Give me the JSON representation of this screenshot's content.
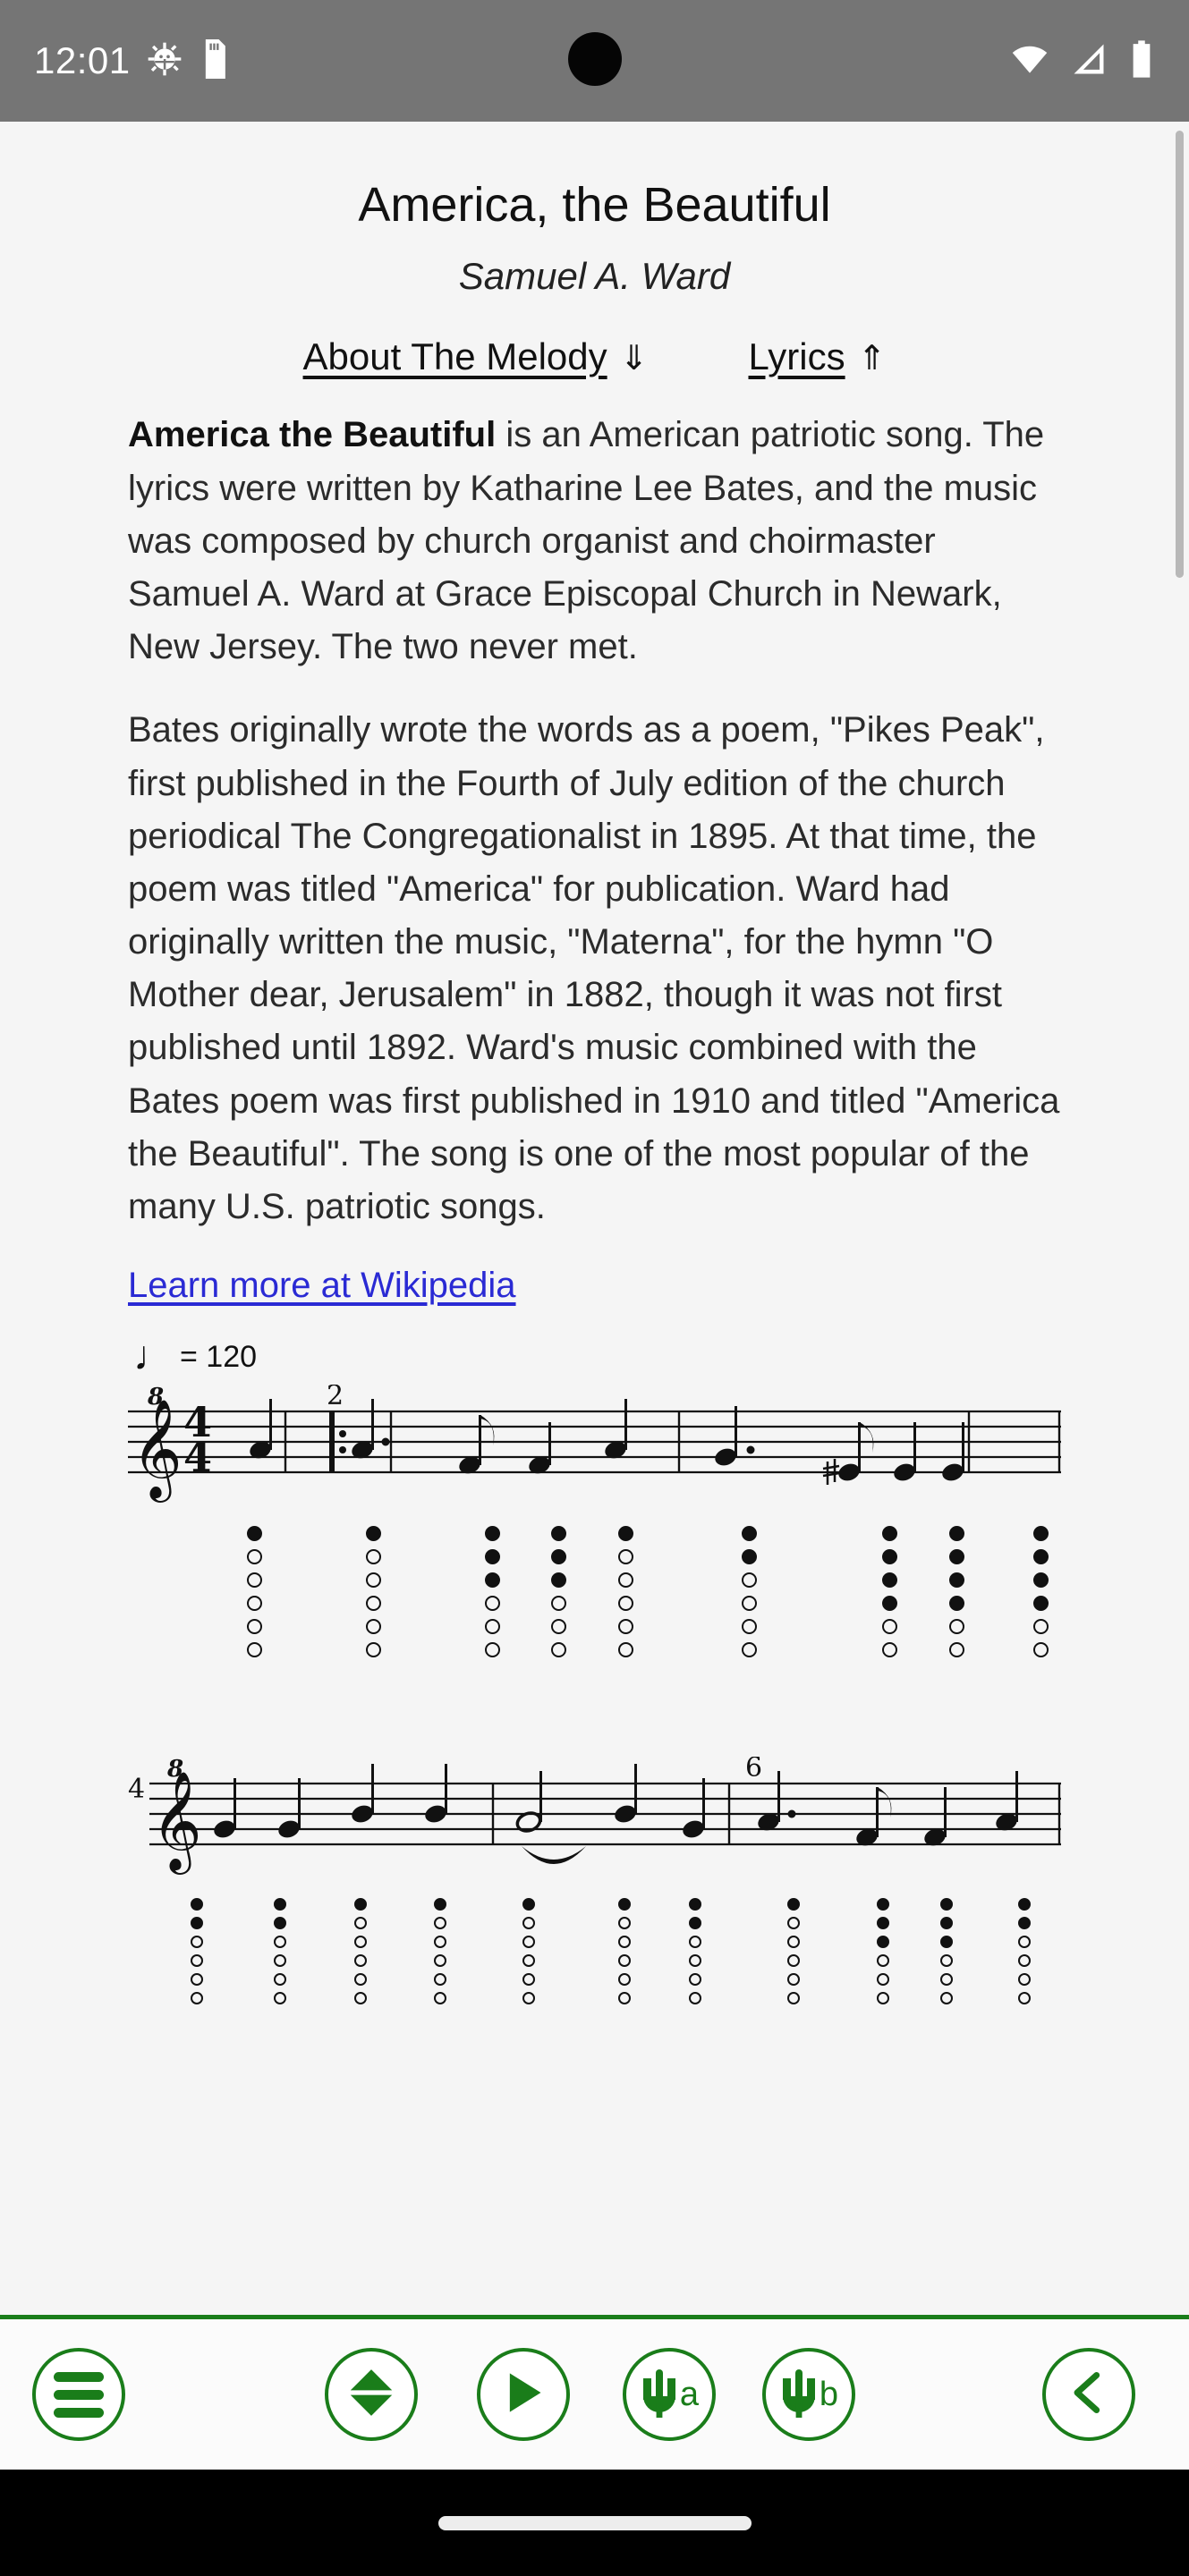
{
  "status_bar": {
    "clock": "12:01",
    "icons_left": [
      "android-debug-icon",
      "sim-card-icon"
    ],
    "icons_right": [
      "wifi-icon",
      "signal-icon",
      "battery-icon"
    ],
    "background_color": "#757575"
  },
  "song": {
    "title": "America, the Beautiful",
    "composer": "Samuel A. Ward"
  },
  "nav": {
    "about_label": "About The Melody",
    "about_arrow": "⇓",
    "lyrics_label": "Lyrics",
    "lyrics_arrow": "⇑"
  },
  "about": {
    "paragraph1_bold": "America the Beautiful",
    "paragraph1_rest": " is an American patriotic song. The lyrics were written by Katharine Lee Bates, and the music was composed by church organist and choirmaster Samuel A. Ward at Grace Episcopal Church in Newark, New Jersey. The two never met.",
    "paragraph2": "Bates originally wrote the words as a poem, \"Pikes Peak\", first published in the Fourth of July edition of the church periodical The Congregationalist in 1895. At that time, the poem was titled \"America\" for publication. Ward had originally written the music, \"Materna\", for the hymn \"O Mother dear, Jerusalem\" in 1882, though it was not first published until 1892. Ward's music combined with the Bates poem was first published in 1910 and titled \"America the Beautiful\". The song is one of the most popular of the many U.S. patriotic songs.",
    "wikipedia_link": "Learn more at Wikipedia",
    "link_color": "#2a2ad4"
  },
  "score": {
    "tempo_note_glyph": "♩",
    "tempo_text": "= 120",
    "tempo_bpm": 120,
    "clef": "treble-8vb",
    "time_signature_top": "4",
    "time_signature_bottom": "4",
    "systems": [
      {
        "start_measure_label": "",
        "measure_labels": [
          "2"
        ]
      },
      {
        "start_measure_label": "4",
        "measure_labels": [
          "6"
        ]
      }
    ]
  },
  "toolbar": {
    "accent_color": "#1a7d1a",
    "buttons": [
      {
        "name": "menu-button",
        "icon": "hamburger-icon",
        "label": ""
      },
      {
        "name": "transpose-button",
        "icon": "up-down-arrows-icon",
        "label": ""
      },
      {
        "name": "play-button",
        "icon": "play-icon",
        "label": ""
      },
      {
        "name": "tuning-fork-a-button",
        "icon": "tuning-fork-icon",
        "label": "a"
      },
      {
        "name": "tuning-fork-b-button",
        "icon": "tuning-fork-icon",
        "label": "b"
      },
      {
        "name": "back-button",
        "icon": "chevron-left-icon",
        "label": ""
      }
    ]
  },
  "nav_bar": {
    "gesture_pill": "home-indicator"
  }
}
